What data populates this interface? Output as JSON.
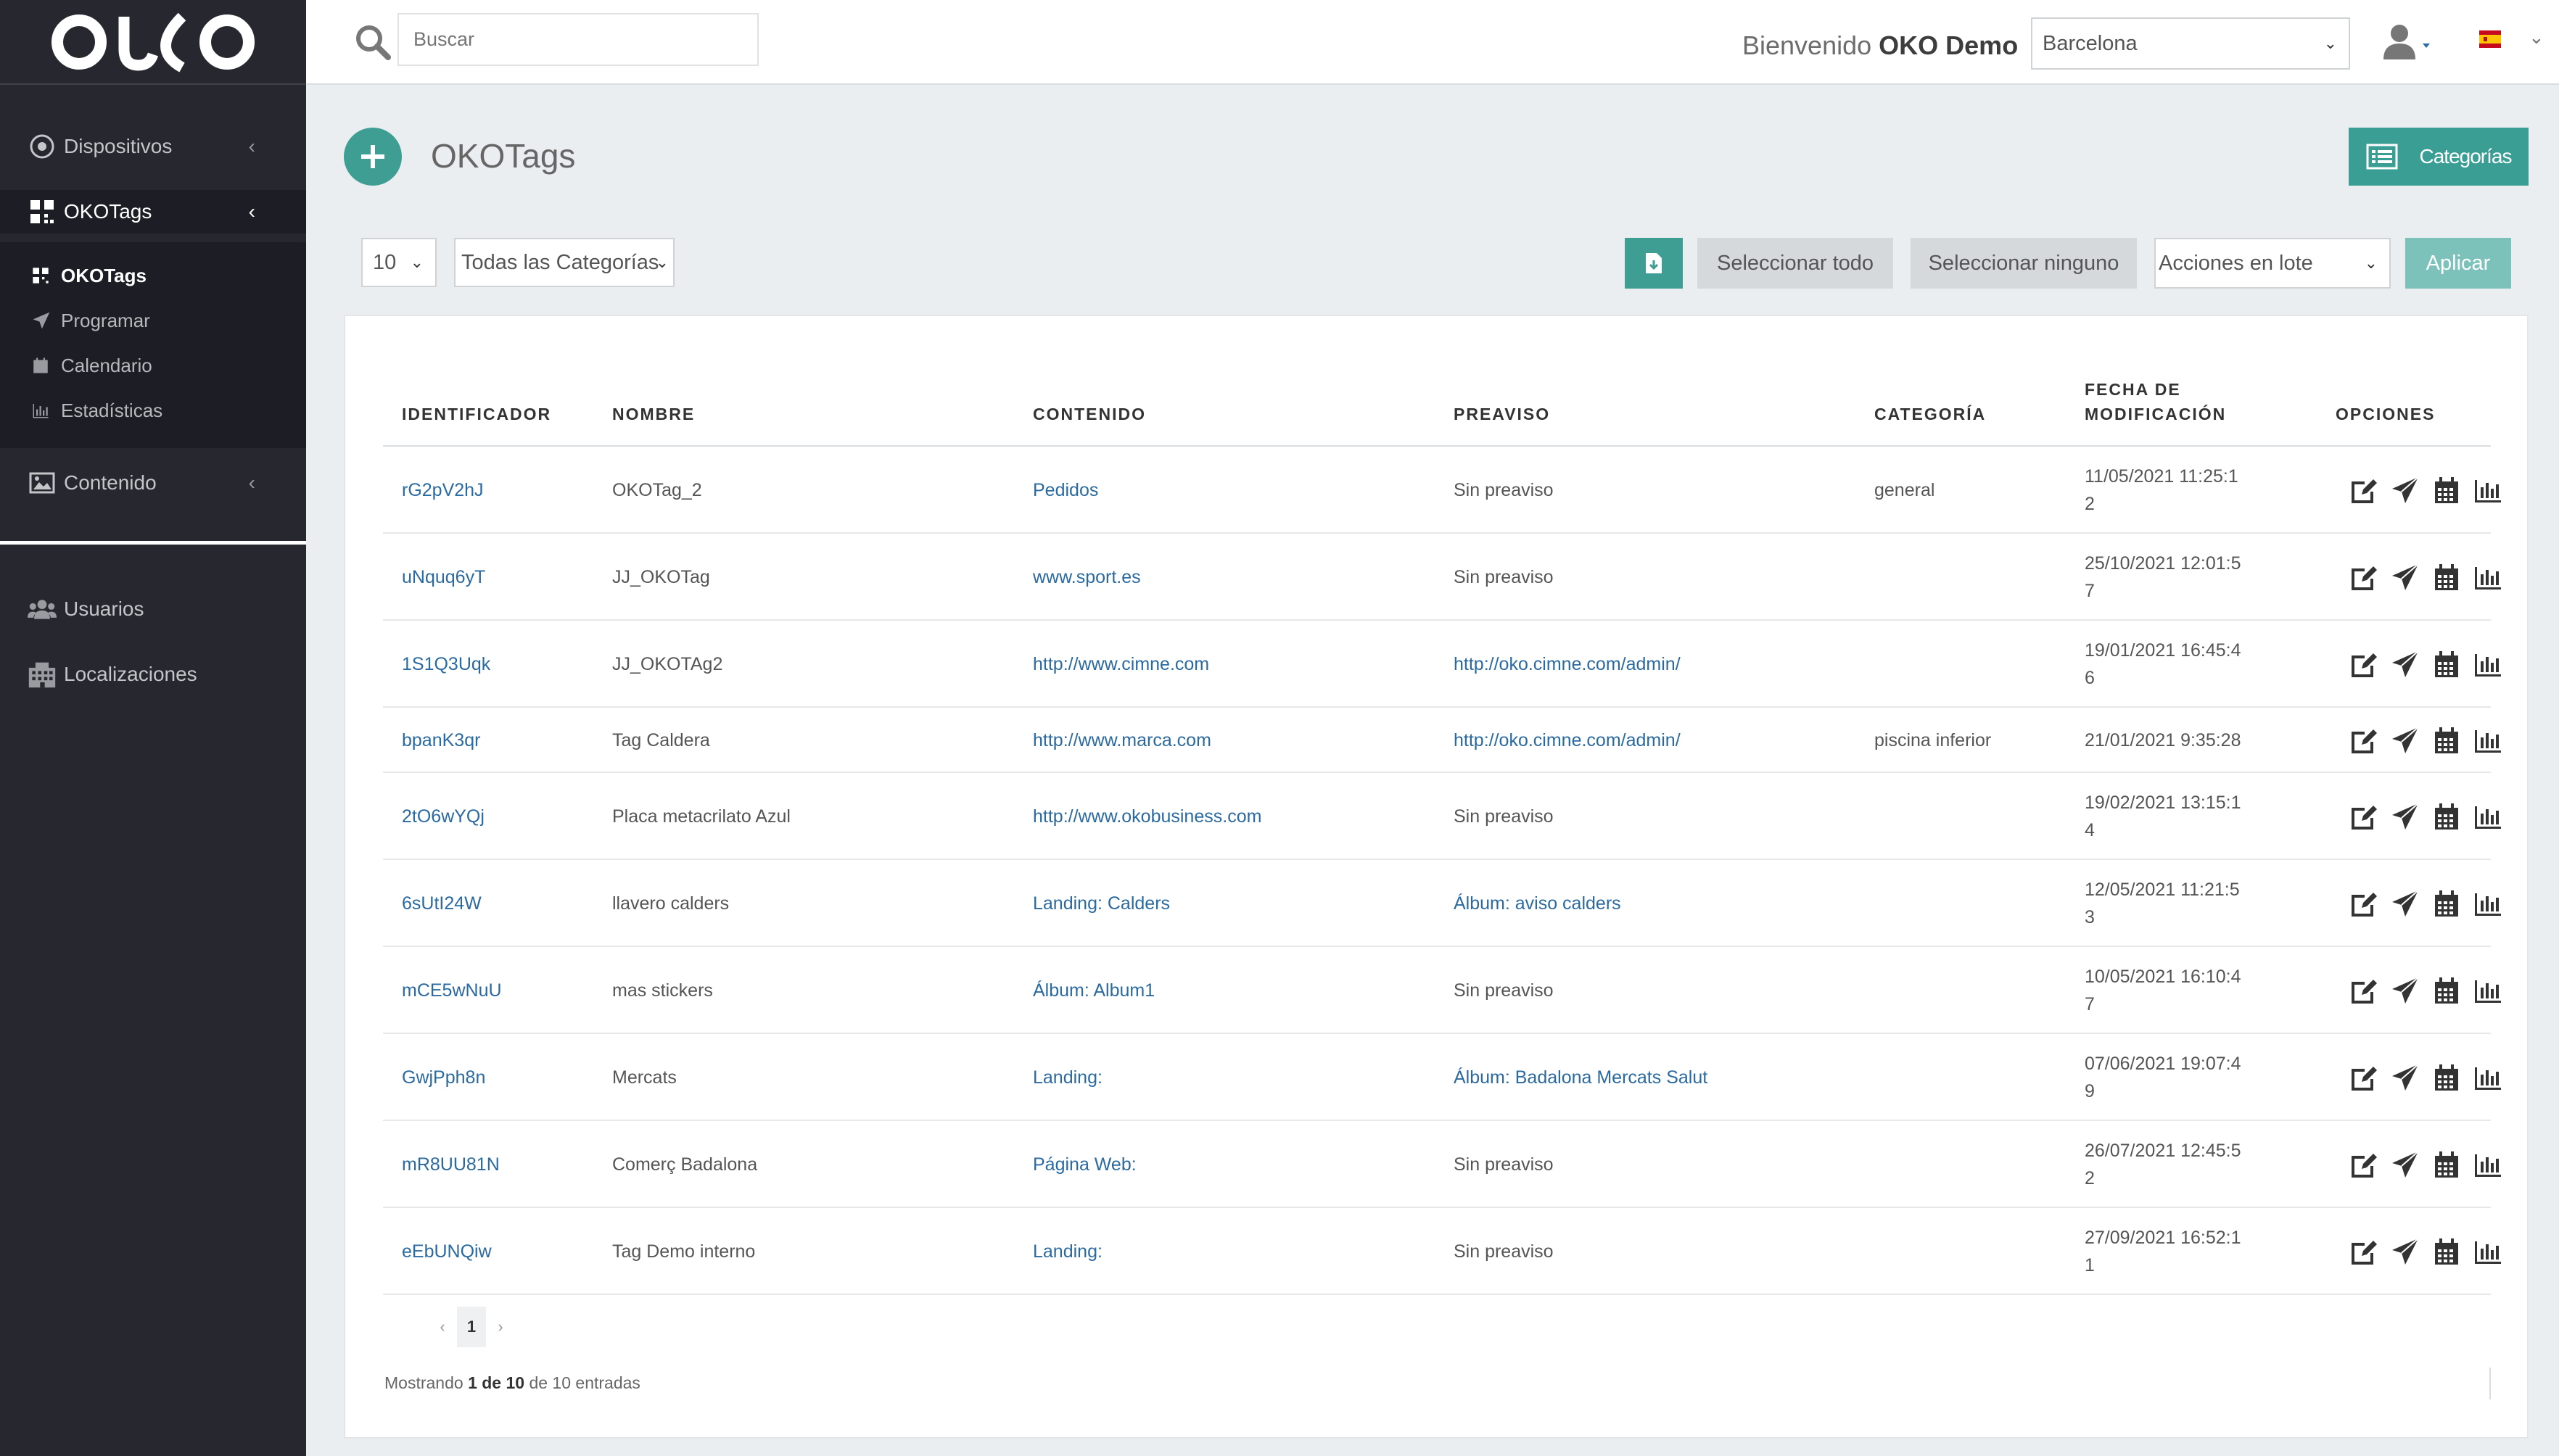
{
  "brand": {
    "logo": "OKO"
  },
  "sidebar": {
    "main": [
      {
        "label": "Dispositivos",
        "icon": "target-icon"
      },
      {
        "label": "OKOTags",
        "icon": "qr-icon"
      }
    ],
    "sub": [
      {
        "label": "OKOTags",
        "icon": "qr-icon"
      },
      {
        "label": "Programar",
        "icon": "send-icon"
      },
      {
        "label": "Calendario",
        "icon": "calendar-icon"
      },
      {
        "label": "Estadísticas",
        "icon": "chart-icon"
      }
    ],
    "contenido": {
      "label": "Contenido",
      "icon": "image-icon"
    },
    "usuarios": {
      "label": "Usuarios",
      "icon": "users-icon"
    },
    "localizaciones": {
      "label": "Localizaciones",
      "icon": "building-icon"
    }
  },
  "topbar": {
    "search_placeholder": "Buscar",
    "welcome_prefix": "Bienvenido",
    "welcome_user": "OKO Demo",
    "location": "Barcelona"
  },
  "page": {
    "title": "OKOTags",
    "categories_button": "Categorías"
  },
  "filters": {
    "page_size": "10",
    "category": "Todas las Categorías",
    "select_all": "Seleccionar todo",
    "select_none": "Seleccionar ninguno",
    "bulk_actions": "Acciones en lote",
    "apply": "Aplicar"
  },
  "table": {
    "headers": {
      "id": "IDENTIFICADOR",
      "name": "NOMBRE",
      "content": "CONTENIDO",
      "notice": "PREAVISO",
      "category": "CATEGORÍA",
      "date_1": "FECHA DE",
      "date_2": "MODIFICACIÓN",
      "options": "OPCIONES"
    },
    "rows": [
      {
        "id": "rG2pV2hJ",
        "name": "OKOTag_2",
        "content": "Pedidos",
        "notice": "Sin preaviso",
        "category": "general",
        "date_1": "11/05/2021 11:25:1",
        "date_2": "2"
      },
      {
        "id": "uNquq6yT",
        "name": "JJ_OKOTag",
        "content": "www.sport.es",
        "notice": "Sin preaviso",
        "category": "",
        "date_1": "25/10/2021 12:01:5",
        "date_2": "7"
      },
      {
        "id": "1S1Q3Uqk",
        "name": "JJ_OKOTAg2",
        "content": "http://www.cimne.com",
        "notice": "http://oko.cimne.com/admin/",
        "category": "",
        "date_1": "19/01/2021 16:45:4",
        "date_2": "6"
      },
      {
        "id": "bpanK3qr",
        "name": "Tag Caldera",
        "content": "http://www.marca.com",
        "notice": "http://oko.cimne.com/admin/",
        "category": "piscina inferior",
        "date_1": "21/01/2021 9:35:28",
        "date_2": ""
      },
      {
        "id": "2tO6wYQj",
        "name": "Placa metacrilato Azul",
        "content": "http://www.okobusiness.com",
        "notice": "Sin preaviso",
        "category": "",
        "date_1": "19/02/2021 13:15:1",
        "date_2": "4"
      },
      {
        "id": "6sUtI24W",
        "name": "llavero calders",
        "content": "Landing: Calders",
        "notice": "Álbum: aviso calders",
        "category": "",
        "date_1": "12/05/2021 11:21:5",
        "date_2": "3"
      },
      {
        "id": "mCE5wNuU",
        "name": "mas stickers",
        "content": "Álbum: Album1",
        "notice": "Sin preaviso",
        "category": "",
        "date_1": "10/05/2021 16:10:4",
        "date_2": "7"
      },
      {
        "id": "GwjPph8n",
        "name": "Mercats",
        "content": "Landing:",
        "notice": "Álbum: Badalona Mercats Salut",
        "category": "",
        "date_1": "07/06/2021 19:07:4",
        "date_2": "9"
      },
      {
        "id": "mR8UU81N",
        "name": "Comerç Badalona",
        "content": "Página Web:",
        "notice": "Sin preaviso",
        "category": "",
        "date_1": "26/07/2021 12:45:5",
        "date_2": "2"
      },
      {
        "id": "eEbUNQiw",
        "name": "Tag Demo interno",
        "content": "Landing:",
        "notice": "Sin preaviso",
        "category": "",
        "date_1": "27/09/2021 16:52:1",
        "date_2": "1"
      }
    ]
  },
  "pagination": {
    "current": "1"
  },
  "footer": {
    "prefix": "Mostrando",
    "range": "1 de 10",
    "suffix": "de 10 entradas"
  },
  "colors": {
    "accent": "#3f9e94",
    "sidebar": "#26272f",
    "link": "#2a6aa0"
  }
}
